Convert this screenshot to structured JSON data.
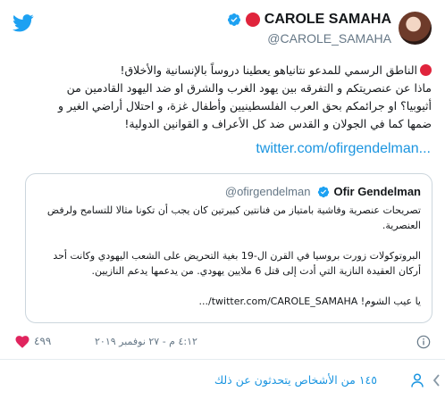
{
  "author": {
    "display_name": "CAROLE SAMAHA",
    "handle": "@CAROLE_SAMAHA"
  },
  "tweet": {
    "line1": "الناطق الرسمي للمدعو نتانياهو يعطينا دروساً بالإنسانية والأخلاق!",
    "line2": "ماذا عن عنصريتكم و التفرقه بين يهود الغرب والشرق او ضد اليهود القادمين من",
    "line3": "أثيوبيا؟ او جرائمكم بحق العرب الفلسطينيين وأطفال غزة، و احتلال أراضي الغير و",
    "line4": "ضمها كما في الجولان و القدس ضد كل الأعراف و القوانين الدولية!",
    "link": "twitter.com/ofirgendelman..."
  },
  "quote": {
    "name": "Ofir Gendelman",
    "handle": "@ofirgendelman",
    "para1": "تصريحات عنصرية وفاشية بامتياز من فنانتين كبيرتين كان يجب أن تكونا مثالا للتسامح ولرفض العنصرية.",
    "para2": "البروتوكولات زورت بروسيا في القرن ال-19 بغية التحريض على الشعب اليهودي وكانت أحد أركان العقيدة النازية التي أدت إلى قتل 6 ملايين يهودي. من يدعمها يدعم النازيين.",
    "para3": "يا عيب الشوم! twitter.com/CAROLE_SAMAHA/..."
  },
  "meta": {
    "timestamp": "٤:١٢ م - ٢٧ نوفمبر ٢٠١٩",
    "like_count": "٤٩٩"
  },
  "footer": {
    "people_talking": "١٤٥ من الأشخاص يتحدثون عن ذلك"
  },
  "colors": {
    "link_blue": "#1b95e0",
    "verified_blue": "#1da1f2",
    "red_emoji": "#e0243c",
    "heart_red": "#e0245e",
    "muted_gray": "#657786"
  }
}
